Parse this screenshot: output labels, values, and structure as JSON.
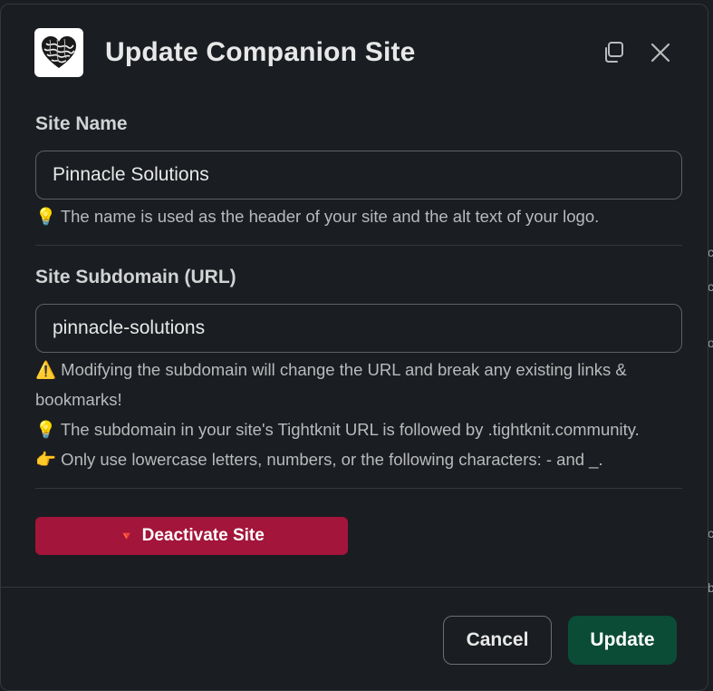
{
  "modal": {
    "title": "Update Companion Site",
    "logo_icon": "heart-knot-logo",
    "header_icons": [
      "popout-icon",
      "close-icon"
    ]
  },
  "site_name": {
    "label": "Site Name",
    "value": "Pinnacle Solutions",
    "hint": "💡 The name is used as the header of your site and the alt text of your logo."
  },
  "subdomain": {
    "label": "Site Subdomain (URL)",
    "value": "pinnacle-solutions",
    "hints": [
      "⚠️ Modifying the subdomain will change the URL and break any existing links &",
      "bookmarks!",
      "💡 The subdomain in your site's Tightknit URL is followed by .tightknit.community.",
      "👉 Only use lowercase letters, numbers, or the following characters: - and _."
    ]
  },
  "deactivate": {
    "icon": "🔻",
    "label": "Deactivate Site"
  },
  "footer": {
    "cancel_label": "Cancel",
    "update_label": "Update"
  },
  "colors": {
    "background": "#1a1d21",
    "danger": "#a3153a",
    "primary": "#0b4c36",
    "border": "#5e6064"
  }
}
